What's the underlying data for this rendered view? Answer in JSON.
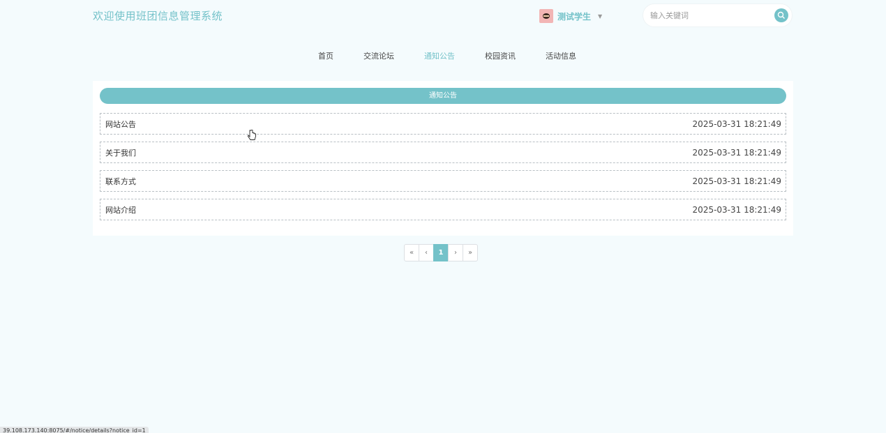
{
  "header": {
    "site_title": "欢迎使用班团信息管理系统",
    "user_name": "测试学生",
    "search_placeholder": "输入关键词"
  },
  "nav": {
    "items": [
      {
        "label": "首页"
      },
      {
        "label": "交流论坛"
      },
      {
        "label": "通知公告"
      },
      {
        "label": "校园资讯"
      },
      {
        "label": "活动信息"
      }
    ],
    "active": "通知公告"
  },
  "section": {
    "title": "通知公告"
  },
  "notices": [
    {
      "title": "网站公告",
      "date": "2025-03-31 18:21:49"
    },
    {
      "title": "关于我们",
      "date": "2025-03-31 18:21:49"
    },
    {
      "title": "联系方式",
      "date": "2025-03-31 18:21:49"
    },
    {
      "title": "网站介绍",
      "date": "2025-03-31 18:21:49"
    }
  ],
  "pagination": {
    "first": "«",
    "prev": "‹",
    "current": "1",
    "next": "›",
    "last": "»"
  },
  "status_url": "39.108.173.140:8075/#/notice/details?notice_id=1",
  "colors": {
    "accent": "#74c2c9",
    "background": "#f4fbfd"
  }
}
